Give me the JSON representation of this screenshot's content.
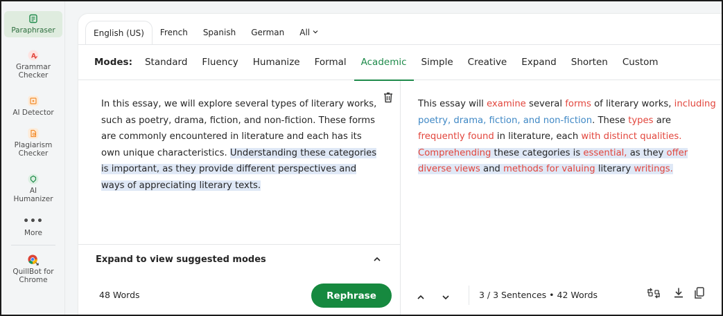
{
  "sidebar": {
    "items": [
      {
        "label": "Paraphraser",
        "icon": "paraphraser-icon",
        "color": "#1e8a4a",
        "active": true
      },
      {
        "label": "Grammar\nChecker",
        "icon": "grammar-checker-icon",
        "color": "#e2453c"
      },
      {
        "label": "AI Detector",
        "icon": "ai-detector-icon",
        "color": "#f28b2c"
      },
      {
        "label": "Plagiarism\nChecker",
        "icon": "plagiarism-checker-icon",
        "color": "#f28b2c"
      },
      {
        "label": "AI\nHumanizer",
        "icon": "ai-humanizer-icon",
        "color": "#1e8a4a"
      },
      {
        "label": "More",
        "icon": "more-icon",
        "color": "#4b4b4b"
      },
      {
        "label": "QuillBot for\nChrome",
        "icon": "chrome-icon",
        "color": "#4285f4"
      }
    ]
  },
  "languages": {
    "tabs": [
      "English (US)",
      "French",
      "Spanish",
      "German"
    ],
    "all_label": "All",
    "active": "English (US)"
  },
  "modes": {
    "title": "Modes:",
    "items": [
      "Standard",
      "Fluency",
      "Humanize",
      "Formal",
      "Academic",
      "Simple",
      "Creative",
      "Expand",
      "Shorten",
      "Custom"
    ],
    "active": "Academic"
  },
  "input": {
    "text_plain": "In this essay, we will explore several types of literary works, such as poetry, drama, fiction, and non-fiction. These forms are commonly encountered in literature and each has its own unique characteristics. ",
    "text_highlighted": "Understanding these categories is important, as they provide different perspectives and ways of appreciating literary texts.",
    "expand_label": "Expand to view suggested modes",
    "word_count": "48 Words",
    "rephrase_label": "Rephrase"
  },
  "output": {
    "segments": [
      {
        "t": "This essay will ",
        "k": "n"
      },
      {
        "t": "examine",
        "k": "c"
      },
      {
        "t": " several ",
        "k": "n"
      },
      {
        "t": "forms",
        "k": "c"
      },
      {
        "t": " of literary works, ",
        "k": "n"
      },
      {
        "t": "including",
        "k": "c"
      },
      {
        "t": " poetry, drama, fiction, and non-fiction",
        "k": "s"
      },
      {
        "t": ". These ",
        "k": "n"
      },
      {
        "t": "types",
        "k": "c"
      },
      {
        "t": " are ",
        "k": "n"
      },
      {
        "t": "frequently found",
        "k": "c"
      },
      {
        "t": " in literature, each ",
        "k": "n"
      },
      {
        "t": "with distinct qualities.",
        "k": "c"
      },
      {
        "t": " ",
        "k": "n"
      },
      {
        "t": "Comprehending",
        "k": "ch"
      },
      {
        "t": " these categories is ",
        "k": "h"
      },
      {
        "t": "essential,",
        "k": "ch"
      },
      {
        "t": " as they ",
        "k": "h"
      },
      {
        "t": "offer diverse views",
        "k": "ch"
      },
      {
        "t": " and ",
        "k": "h"
      },
      {
        "t": "methods for valuing",
        "k": "ch"
      },
      {
        "t": " literary ",
        "k": "h"
      },
      {
        "t": "writings.",
        "k": "ch"
      }
    ],
    "stats": "3 / 3 Sentences  •  42 Words"
  },
  "colors": {
    "accent": "#16893f",
    "change": "#e2453c",
    "structure": "#3f88c5",
    "highlight": "#dfe8f6"
  }
}
